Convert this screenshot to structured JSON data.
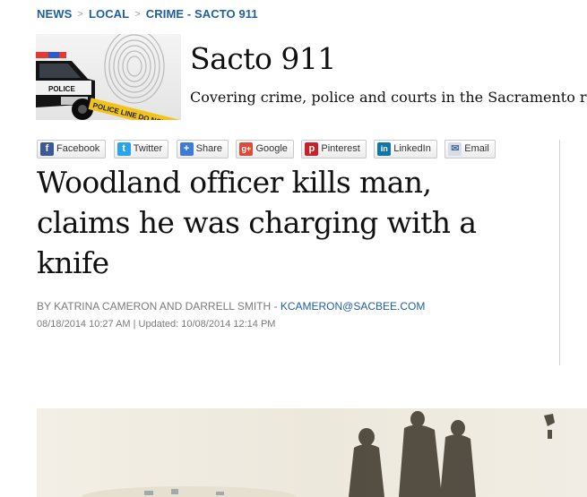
{
  "breadcrumb": {
    "items": [
      "NEWS",
      "LOCAL",
      "CRIME - SACTO 911"
    ],
    "separator": ">"
  },
  "section": {
    "title": "Sacto 911",
    "subtitle": "Covering crime, police and courts in the Sacramento reg",
    "banner_tape_text": "POLICE LINE DO NOT",
    "banner_car_text": "POLICE"
  },
  "share": {
    "buttons": [
      {
        "label": "Facebook",
        "icon": "facebook-icon",
        "color": "#3b5998",
        "glyph": "f"
      },
      {
        "label": "Twitter",
        "icon": "twitter-icon",
        "color": "#2aa3ef",
        "glyph": "t"
      },
      {
        "label": "Share",
        "icon": "share-plus-icon",
        "color": "#3e7bd6",
        "glyph": "+"
      },
      {
        "label": "Google",
        "icon": "google-plus-icon",
        "color": "#dd4b39",
        "glyph": "g+"
      },
      {
        "label": "Pinterest",
        "icon": "pinterest-icon",
        "color": "#cb2027",
        "glyph": "p"
      },
      {
        "label": "LinkedIn",
        "icon": "linkedin-icon",
        "color": "#0e76a8",
        "glyph": "in"
      },
      {
        "label": "Email",
        "icon": "email-icon",
        "color": "#d7dde8",
        "glyph": "✉"
      }
    ]
  },
  "article": {
    "headline": "Woodland officer kills man, claims he was charging with a knife",
    "byline_prefix": "BY KATRINA CAMERON AND DARRELL SMITH - ",
    "byline_email": "KCAMERON@SACBEE.COM",
    "dateline": "08/18/2014 10:27 AM | Updated: 10/08/2014 12:14 PM"
  },
  "colors": {
    "link_blue": "#1f5fa0",
    "meta_gray": "#7a7a7a"
  }
}
